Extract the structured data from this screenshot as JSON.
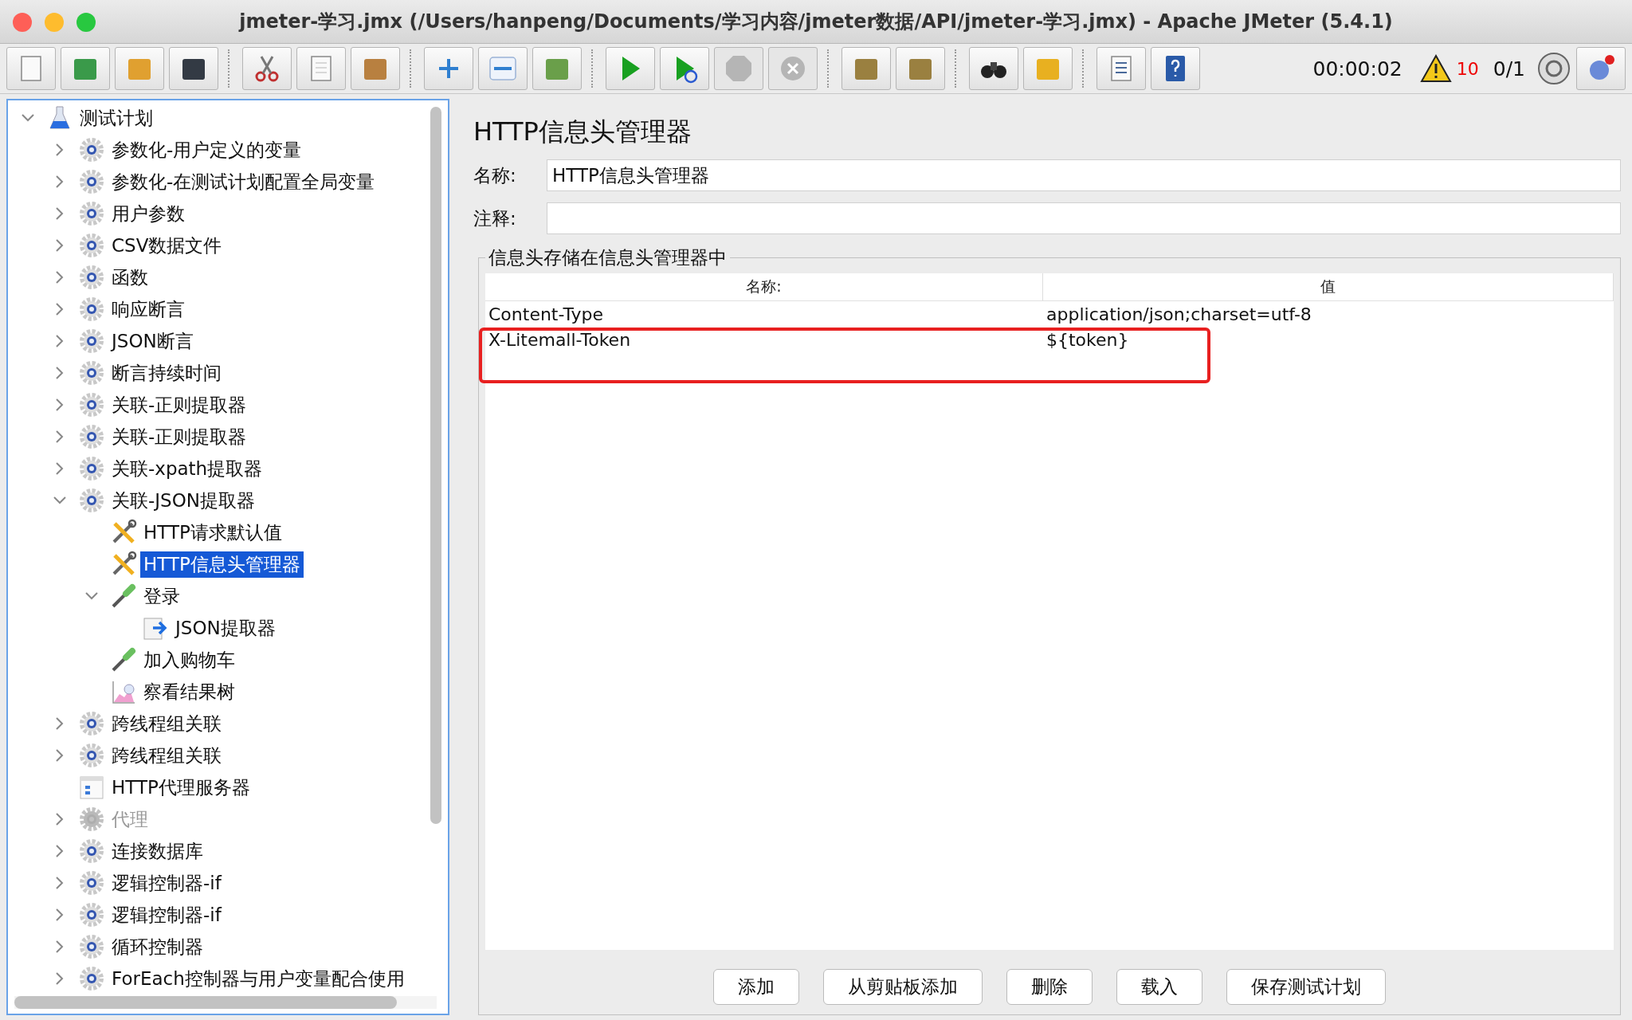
{
  "window": {
    "title": "jmeter-学习.jmx (/Users/hanpeng/Documents/学习内容/jmeter数据/API/jmeter-学习.jmx) - Apache JMeter (5.4.1)"
  },
  "toolbar": {
    "groups": [
      [
        {
          "kind": "new",
          "disabled": false
        },
        {
          "kind": "templates",
          "disabled": false
        },
        {
          "kind": "open",
          "disabled": false
        },
        {
          "kind": "save",
          "disabled": false
        }
      ],
      [
        {
          "kind": "cut",
          "disabled": false
        },
        {
          "kind": "copy",
          "disabled": false
        },
        {
          "kind": "paste",
          "disabled": false
        }
      ],
      [
        {
          "kind": "expand",
          "disabled": false
        },
        {
          "kind": "collapse",
          "disabled": false
        },
        {
          "kind": "toggle",
          "disabled": false
        }
      ],
      [
        {
          "kind": "start",
          "disabled": false
        },
        {
          "kind": "start-no-timers",
          "disabled": false
        },
        {
          "kind": "stop",
          "disabled": true
        },
        {
          "kind": "shutdown",
          "disabled": true
        }
      ],
      [
        {
          "kind": "clear",
          "disabled": false
        },
        {
          "kind": "clear-all",
          "disabled": false
        }
      ],
      [
        {
          "kind": "search",
          "disabled": false
        },
        {
          "kind": "reset-search",
          "disabled": false
        }
      ],
      [
        {
          "kind": "function-helper",
          "disabled": false
        },
        {
          "kind": "help",
          "disabled": false
        }
      ]
    ],
    "elapsed": "00:00:02",
    "warnings": "10",
    "threads": "0/1"
  },
  "tree": {
    "items": [
      {
        "label": "测试计划",
        "kind": "plan",
        "expanded": true,
        "selected": false,
        "disabled": false,
        "children": [
          {
            "label": "参数化-用户定义的变量",
            "kind": "gear",
            "expanded": false,
            "selected": false,
            "disabled": false
          },
          {
            "label": "参数化-在测试计划配置全局变量",
            "kind": "gear",
            "expanded": false,
            "selected": false,
            "disabled": false
          },
          {
            "label": "用户参数",
            "kind": "gear",
            "expanded": false,
            "selected": false,
            "disabled": false
          },
          {
            "label": "CSV数据文件",
            "kind": "gear",
            "expanded": false,
            "selected": false,
            "disabled": false
          },
          {
            "label": "函数",
            "kind": "gear",
            "expanded": false,
            "selected": false,
            "disabled": false
          },
          {
            "label": "响应断言",
            "kind": "gear",
            "expanded": false,
            "selected": false,
            "disabled": false
          },
          {
            "label": "JSON断言",
            "kind": "gear",
            "expanded": false,
            "selected": false,
            "disabled": false
          },
          {
            "label": "断言持续时间",
            "kind": "gear",
            "expanded": false,
            "selected": false,
            "disabled": false
          },
          {
            "label": "关联-正则提取器",
            "kind": "gear",
            "expanded": false,
            "selected": false,
            "disabled": false
          },
          {
            "label": "关联-正则提取器",
            "kind": "gear",
            "expanded": false,
            "selected": false,
            "disabled": false
          },
          {
            "label": "关联-xpath提取器",
            "kind": "gear",
            "expanded": false,
            "selected": false,
            "disabled": false
          },
          {
            "label": "关联-JSON提取器",
            "kind": "gear",
            "expanded": true,
            "selected": false,
            "disabled": false,
            "children": [
              {
                "label": "HTTP请求默认值",
                "kind": "tool",
                "selected": false,
                "disabled": false
              },
              {
                "label": "HTTP信息头管理器",
                "kind": "tool",
                "selected": true,
                "disabled": false
              },
              {
                "label": "登录",
                "kind": "sampler",
                "expanded": true,
                "selected": false,
                "disabled": false,
                "children": [
                  {
                    "label": "JSON提取器",
                    "kind": "extractor",
                    "selected": false,
                    "disabled": false
                  }
                ]
              },
              {
                "label": "加入购物车",
                "kind": "sampler",
                "selected": false,
                "disabled": false
              },
              {
                "label": "察看结果树",
                "kind": "listener",
                "selected": false,
                "disabled": false
              }
            ]
          },
          {
            "label": "跨线程组关联",
            "kind": "gear",
            "expanded": false,
            "selected": false,
            "disabled": false
          },
          {
            "label": "跨线程组关联",
            "kind": "gear",
            "expanded": false,
            "selected": false,
            "disabled": false
          },
          {
            "label": "HTTP代理服务器",
            "kind": "proxy",
            "selected": false,
            "disabled": false
          },
          {
            "label": "代理",
            "kind": "gear",
            "expanded": false,
            "selected": false,
            "disabled": true
          },
          {
            "label": "连接数据库",
            "kind": "gear",
            "expanded": false,
            "selected": false,
            "disabled": false
          },
          {
            "label": "逻辑控制器-if",
            "kind": "gear",
            "expanded": false,
            "selected": false,
            "disabled": false
          },
          {
            "label": "逻辑控制器-if",
            "kind": "gear",
            "expanded": false,
            "selected": false,
            "disabled": false
          },
          {
            "label": "循环控制器",
            "kind": "gear",
            "expanded": false,
            "selected": false,
            "disabled": false
          },
          {
            "label": "ForEach控制器与用户变量配合使用",
            "kind": "gear",
            "expanded": false,
            "selected": false,
            "disabled": false
          }
        ]
      }
    ]
  },
  "panel": {
    "title": "HTTP信息头管理器",
    "fields": [
      {
        "label": "名称:",
        "value": "HTTP信息头管理器"
      },
      {
        "label": "注释:"
      }
    ],
    "group": {
      "legend": "信息头存储在信息头管理器中",
      "table": {
        "columns": [
          "名称:",
          "值"
        ],
        "rows": [
          [
            "Content-Type",
            "application/json;charset=utf-8"
          ],
          [
            "X-Litemall-Token",
            "${token}"
          ]
        ]
      }
    },
    "buttons": [
      "添加",
      "从剪贴板添加",
      "删除",
      "载入",
      "保存测试计划"
    ]
  }
}
